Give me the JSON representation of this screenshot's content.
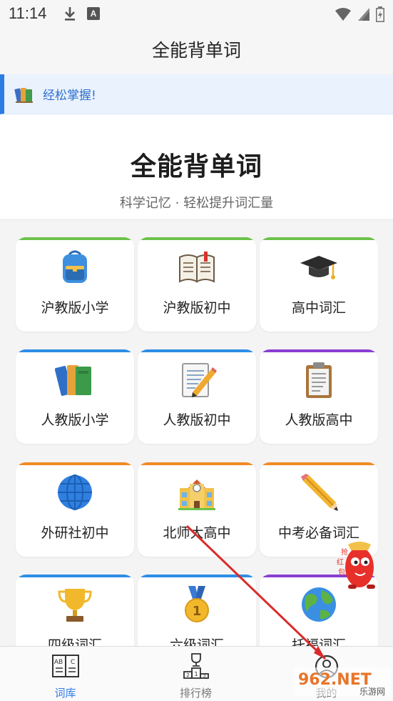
{
  "status_bar": {
    "time": "11:14",
    "icons": [
      "download-icon",
      "a-icon",
      "wifi-icon",
      "signal-icon",
      "battery-icon"
    ]
  },
  "app_bar": {
    "title": "全能背单词"
  },
  "banner": {
    "text": "经松掌握!",
    "icon": "books-icon",
    "accent_color": "#2d7be5"
  },
  "hero": {
    "title": "全能背单词",
    "subtitle": "科学记忆 · 轻松提升词汇量"
  },
  "categories": [
    {
      "label": "沪教版小学",
      "icon": "backpack-icon",
      "color": "#6cc24a"
    },
    {
      "label": "沪教版初中",
      "icon": "open-book-icon",
      "color": "#6cc24a"
    },
    {
      "label": "高中词汇",
      "icon": "graduation-cap-icon",
      "color": "#6cc24a"
    },
    {
      "label": "人教版小学",
      "icon": "books-icon",
      "color": "#2d8ee6"
    },
    {
      "label": "人教版初中",
      "icon": "memo-icon",
      "color": "#2d8ee6"
    },
    {
      "label": "人教版高中",
      "icon": "clipboard-icon",
      "color": "#8a3fd1"
    },
    {
      "label": "外研社初中",
      "icon": "globe-icon",
      "color": "#f08a24"
    },
    {
      "label": "北师大高中",
      "icon": "school-icon",
      "color": "#f08a24"
    },
    {
      "label": "中考必备词汇",
      "icon": "pencil-icon",
      "color": "#f08a24"
    },
    {
      "label": "四级词汇",
      "icon": "trophy-icon",
      "color": "#2d8ee6"
    },
    {
      "label": "六级词汇",
      "icon": "medal-icon",
      "color": "#2d8ee6"
    },
    {
      "label": "托福词汇",
      "icon": "earth-icon",
      "color": "#8a3fd1"
    }
  ],
  "bottom_nav": {
    "tabs": [
      {
        "label": "词库",
        "icon": "dictionary-icon",
        "active": true
      },
      {
        "label": "排行榜",
        "icon": "podium-icon",
        "active": false
      },
      {
        "label": "我的",
        "icon": "profile-icon",
        "active": false
      }
    ],
    "active_color": "#2d7be5",
    "inactive_color": "#777777"
  },
  "watermark": {
    "text": "962.NET",
    "subtext": "乐游网"
  },
  "mascot": {
    "text": "抢红包"
  }
}
